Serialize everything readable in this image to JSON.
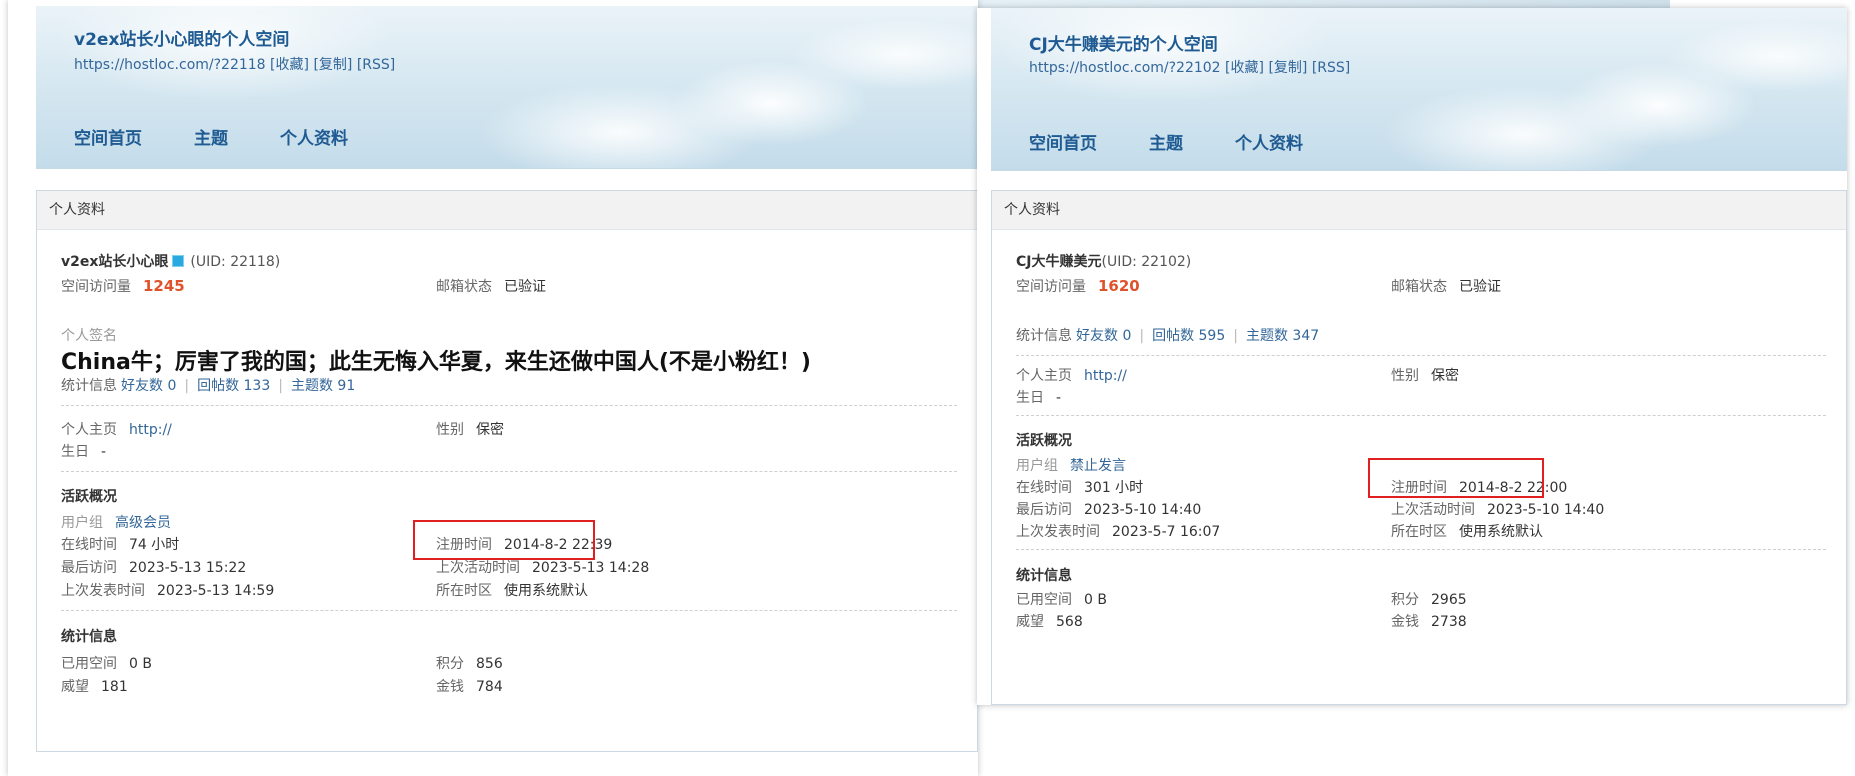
{
  "left": {
    "title": "v2ex站长小心眼的个人空间",
    "url": "https://hostloc.com/?22118",
    "links": [
      "[收藏]",
      "[复制]",
      "[RSS]"
    ],
    "nav": [
      "空间首页",
      "主题",
      "个人资料"
    ],
    "box_title": "个人资料",
    "username": "v2ex站长小心眼",
    "uid": "(UID: 22118)",
    "visits_label": "空间访问量",
    "visits": "1245",
    "email_label": "邮箱状态",
    "email": "已验证",
    "sig_label": "个人签名",
    "signature": "China牛；厉害了我的国；此生无悔入华夏，来生还做中国人(不是小粉红！)",
    "stats_label": "统计信息",
    "friends": "好友数 0",
    "replies": "回帖数 133",
    "topics": "主题数 91",
    "homepage_label": "个人主页",
    "homepage": "http://",
    "gender_label": "性别",
    "gender": "保密",
    "birthday_label": "生日",
    "birthday": "-",
    "activity_title": "活跃概况",
    "group_label": "用户组",
    "group": "高级会员",
    "online_label": "在线时间",
    "online": "74 小时",
    "reg_label": "注册时间",
    "reg": "2014-8-2 22:39",
    "last_visit_label": "最后访问",
    "last_visit": "2023-5-13 15:22",
    "last_active_label": "上次活动时间",
    "last_active": "2023-5-13 14:28",
    "last_post_label": "上次发表时间",
    "last_post": "2023-5-13 14:59",
    "tz_label": "所在时区",
    "tz": "使用系统默认",
    "stat_title": "统计信息",
    "space_label": "已用空间",
    "space": "0 B",
    "points_label": "积分",
    "points": "856",
    "prestige_label": "威望",
    "prestige": "181",
    "money_label": "金钱",
    "money": "784"
  },
  "right": {
    "title": "CJ大牛赚美元的个人空间",
    "url": "https://hostloc.com/?22102",
    "links": [
      "[收藏]",
      "[复制]",
      "[RSS]"
    ],
    "nav": [
      "空间首页",
      "主题",
      "个人资料"
    ],
    "box_title": "个人资料",
    "username": "CJ大牛赚美元",
    "uid": "(UID: 22102)",
    "visits_label": "空间访问量",
    "visits": "1620",
    "email_label": "邮箱状态",
    "email": "已验证",
    "stats_label": "统计信息",
    "friends": "好友数 0",
    "replies": "回帖数 595",
    "topics": "主题数 347",
    "homepage_label": "个人主页",
    "homepage": "http://",
    "gender_label": "性别",
    "gender": "保密",
    "birthday_label": "生日",
    "birthday": "-",
    "activity_title": "活跃概况",
    "group_label": "用户组",
    "group": "禁止发言",
    "online_label": "在线时间",
    "online": "301 小时",
    "reg_label": "注册时间",
    "reg": "2014-8-2 22:00",
    "last_visit_label": "最后访问",
    "last_visit": "2023-5-10 14:40",
    "last_active_label": "上次活动时间",
    "last_active": "2023-5-10 14:40",
    "last_post_label": "上次发表时间",
    "last_post": "2023-5-7 16:07",
    "tz_label": "所在时区",
    "tz": "使用系统默认",
    "stat_title": "统计信息",
    "space_label": "已用空间",
    "space": "0 B",
    "points_label": "积分",
    "points": "2965",
    "prestige_label": "威望",
    "prestige": "568",
    "money_label": "金钱",
    "money": "2738"
  },
  "colors": {
    "link": "#336699",
    "title": "#1f5b92",
    "visits": "#e0522c",
    "highlight": "#e02020"
  }
}
